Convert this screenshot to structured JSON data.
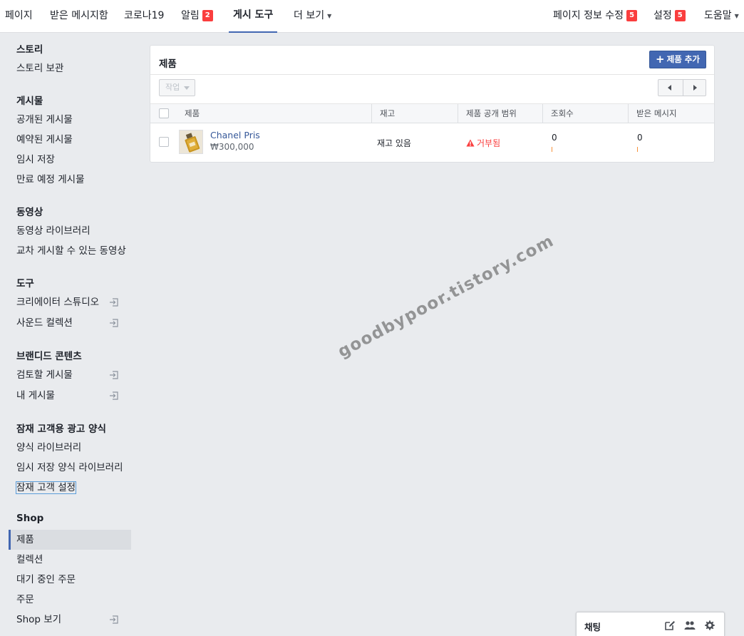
{
  "nav": {
    "page": "페이지",
    "inbox": "받은 메시지함",
    "covid": "코로나19",
    "notifications": "알림",
    "notifications_badge": "2",
    "publishing_tools": "게시 도구",
    "more": "더 보기",
    "edit_page_info": "페이지 정보 수정",
    "edit_page_info_badge": "5",
    "settings": "설정",
    "settings_badge": "5",
    "help": "도움말"
  },
  "sidebar": {
    "stories": {
      "title": "스토리",
      "items": [
        "스토리 보관"
      ]
    },
    "posts": {
      "title": "게시물",
      "items": [
        "공개된 게시물",
        "예약된 게시물",
        "임시 저장",
        "만료 예정 게시물"
      ]
    },
    "videos": {
      "title": "동영상",
      "items": [
        "동영상 라이브러리",
        "교차 게시할 수 있는 동영상"
      ]
    },
    "tools": {
      "title": "도구",
      "items": [
        "크리에이터 스튜디오",
        "사운드 컬렉션"
      ]
    },
    "branded": {
      "title": "브랜디드 콘텐츠",
      "items": [
        "검토할 게시물",
        "내 게시물"
      ]
    },
    "lead_ads": {
      "title": "잠재 고객용 광고 양식",
      "items": [
        "양식 라이브러리",
        "임시 저장 양식 라이브러리",
        "잠재 고객 설정"
      ]
    },
    "shop": {
      "title": "Shop",
      "items": [
        "제품",
        "컬렉션",
        "대기 중인 주문",
        "주문",
        "Shop 보기"
      ]
    }
  },
  "panel": {
    "title": "제품",
    "add_button": "제품 추가",
    "action_button": "작업",
    "columns": [
      "제품",
      "재고",
      "제품 공개 범위",
      "조회수",
      "받은 메시지"
    ],
    "rows": [
      {
        "name": "Chanel Pris",
        "price": "₩300,000",
        "stock": "재고 있음",
        "visibility": "거부됨",
        "views": "0",
        "messages": "0"
      }
    ]
  },
  "watermark": "goodbypoor.tistory.com",
  "chat": {
    "label": "채팅"
  },
  "colors": {
    "accent": "#4267b2",
    "badge": "#fa3e3e",
    "link": "#365899"
  }
}
